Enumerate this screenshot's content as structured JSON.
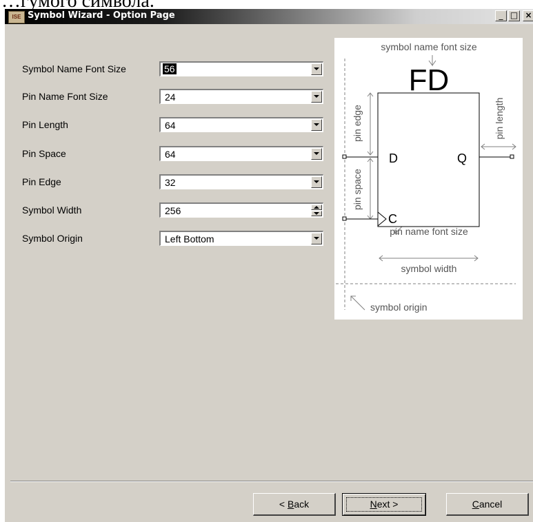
{
  "page_caption": "…гумого символа.",
  "window": {
    "icon_label": "ISE",
    "title": "Symbol Wizard - Option Page",
    "minimize": "_",
    "maximize": "□",
    "close": "×"
  },
  "fields": [
    {
      "label": "Symbol Name Font Size",
      "value": "56",
      "control": "dropdown",
      "selected": true
    },
    {
      "label": "Pin Name Font Size",
      "value": "24",
      "control": "dropdown"
    },
    {
      "label": "Pin Length",
      "value": "64",
      "control": "dropdown"
    },
    {
      "label": "Pin Space",
      "value": "64",
      "control": "dropdown"
    },
    {
      "label": "Pin Edge",
      "value": "32",
      "control": "dropdown"
    },
    {
      "label": "Symbol Width",
      "value": "256",
      "control": "spinner"
    },
    {
      "label": "Symbol Origin",
      "value": "Left Bottom",
      "control": "dropdown"
    }
  ],
  "preview": {
    "symbol_name_font_size": "symbol name font size",
    "symbol_name": "FD",
    "pin_edge": "pin edge",
    "pin_length": "pin length",
    "pin_space": "pin space",
    "pin_d": "D",
    "pin_q": "Q",
    "pin_c": "C",
    "pin_name_font_size": "pin name font size",
    "symbol_width": "symbol width",
    "symbol_origin": "symbol origin"
  },
  "buttons": {
    "back_prefix": "< ",
    "back_key": "B",
    "back_rest": "ack",
    "next_key": "N",
    "next_rest": "ext >",
    "cancel_key": "C",
    "cancel_rest": "ancel"
  }
}
